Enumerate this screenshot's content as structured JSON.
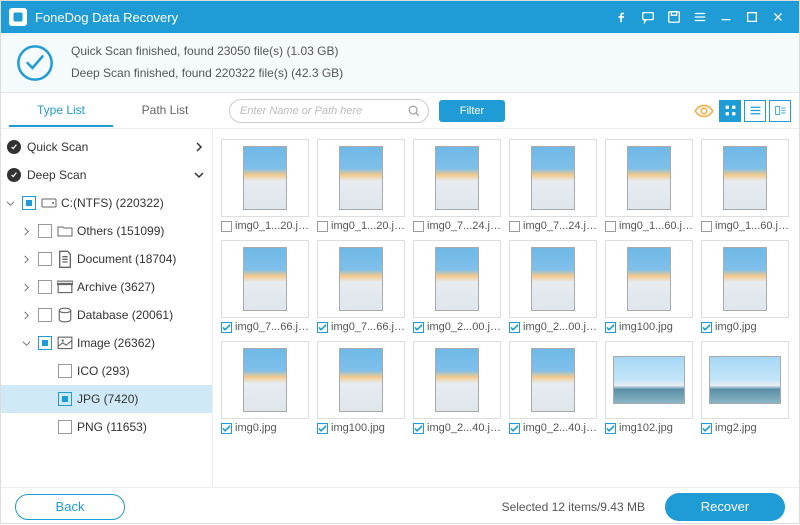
{
  "title": "FoneDog Data Recovery",
  "status": {
    "line1": "Quick Scan finished, found 23050 file(s) (1.03 GB)",
    "line2": "Deep Scan finished, found 220322 file(s) (42.3 GB)"
  },
  "tabs": {
    "type_list": "Type List",
    "path_list": "Path List"
  },
  "search": {
    "placeholder": "Enter Name or Path here"
  },
  "filter_label": "Filter",
  "sidebar": {
    "quick_scan": "Quick Scan",
    "deep_scan": "Deep Scan",
    "drive": "C:(NTFS) (220322)",
    "others": "Others (151099)",
    "document": "Document (18704)",
    "archive": "Archive (3627)",
    "database": "Database (20061)",
    "image": "Image (26362)",
    "ico": "ICO (293)",
    "jpg": "JPG (7420)",
    "png": "PNG (11653)"
  },
  "files": [
    [
      {
        "name": "img0_1...20.jpg",
        "checked": false,
        "wide": false
      },
      {
        "name": "img0_1...20.jpg",
        "checked": false,
        "wide": false
      },
      {
        "name": "img0_7...24.jpg",
        "checked": false,
        "wide": false
      },
      {
        "name": "img0_7...24.jpg",
        "checked": false,
        "wide": false
      },
      {
        "name": "img0_1...60.jpg",
        "checked": false,
        "wide": false
      },
      {
        "name": "img0_1...60.jpg",
        "checked": false,
        "wide": false
      }
    ],
    [
      {
        "name": "img0_7...66.jpg",
        "checked": true,
        "wide": false
      },
      {
        "name": "img0_7...66.jpg",
        "checked": true,
        "wide": false
      },
      {
        "name": "img0_2...00.jpg",
        "checked": true,
        "wide": false
      },
      {
        "name": "img0_2...00.jpg",
        "checked": true,
        "wide": false
      },
      {
        "name": "img100.jpg",
        "checked": true,
        "wide": false
      },
      {
        "name": "img0.jpg",
        "checked": true,
        "wide": false
      }
    ],
    [
      {
        "name": "img0.jpg",
        "checked": true,
        "wide": false
      },
      {
        "name": "img100.jpg",
        "checked": true,
        "wide": false
      },
      {
        "name": "img0_2...40.jpg",
        "checked": true,
        "wide": false
      },
      {
        "name": "img0_2...40.jpg",
        "checked": true,
        "wide": false
      },
      {
        "name": "img102.jpg",
        "checked": true,
        "wide": true
      },
      {
        "name": "img2.jpg",
        "checked": true,
        "wide": true
      }
    ]
  ],
  "footer": {
    "back": "Back",
    "selection": "Selected 12 items/9.43 MB",
    "recover": "Recover"
  }
}
